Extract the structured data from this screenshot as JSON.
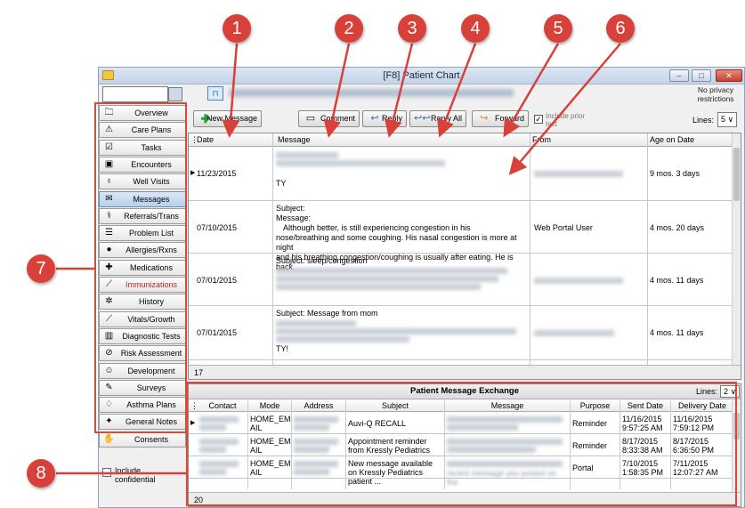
{
  "callouts": [
    "1",
    "2",
    "3",
    "4",
    "5",
    "6",
    "7",
    "8"
  ],
  "window": {
    "title": "[F8] Patient Chart",
    "minimize": "‒",
    "maximize": "□",
    "close": "✕"
  },
  "header": {
    "privacy": "No privacy restrictions"
  },
  "toolbar": {
    "new_message": "New Message",
    "comment": "Comment",
    "reply": "Reply",
    "reply_all": "Reply All",
    "forward": "Forward",
    "include_prior": "Include prior text",
    "include_checked": "✓",
    "lines_label": "Lines:",
    "lines_value": "5 ∨"
  },
  "nav": {
    "items": [
      {
        "label": "Overview",
        "icon": "folder-icon",
        "glyph": "🗀"
      },
      {
        "label": "Care Plans",
        "icon": "warning-icon",
        "glyph": "⚠"
      },
      {
        "label": "Tasks",
        "icon": "checklist-icon",
        "glyph": "☑"
      },
      {
        "label": "Encounters",
        "icon": "encounter-icon",
        "glyph": "▣"
      },
      {
        "label": "Well Visits",
        "icon": "stethoscope-icon",
        "glyph": "♁"
      },
      {
        "label": "Messages",
        "icon": "messages-icon",
        "glyph": "✉"
      },
      {
        "label": "Referrals/Trans",
        "icon": "referral-icon",
        "glyph": "⚕"
      },
      {
        "label": "Problem List",
        "icon": "problem-list-icon",
        "glyph": "☰"
      },
      {
        "label": "Allergies/Rxns",
        "icon": "allergy-icon",
        "glyph": "●"
      },
      {
        "label": "Medications",
        "icon": "medication-icon",
        "glyph": "✚"
      },
      {
        "label": "Immunizations",
        "icon": "syringe-icon",
        "glyph": "⟋"
      },
      {
        "label": "History",
        "icon": "history-icon",
        "glyph": "✲"
      },
      {
        "label": "Vitals/Growth",
        "icon": "vitals-icon",
        "glyph": "⟋"
      },
      {
        "label": "Diagnostic Tests",
        "icon": "diagnostic-icon",
        "glyph": "▥"
      },
      {
        "label": "Risk Assessment",
        "icon": "risk-icon",
        "glyph": "⊘"
      },
      {
        "label": "Development",
        "icon": "development-icon",
        "glyph": "☺"
      },
      {
        "label": "Surveys",
        "icon": "survey-icon",
        "glyph": "✎"
      },
      {
        "label": "Asthma Plans",
        "icon": "asthma-icon",
        "glyph": "♢"
      },
      {
        "label": "General Notes",
        "icon": "notes-icon",
        "glyph": "✦"
      },
      {
        "label": "Consents",
        "icon": "consent-icon",
        "glyph": "✋"
      }
    ],
    "include_confidential": "Include confidential"
  },
  "messages": {
    "columns": [
      "Date",
      "Message",
      "From",
      "Age on Date"
    ],
    "rows": [
      {
        "date": "11/23/2015",
        "message_lines": [
          "",
          "",
          "",
          "TY"
        ],
        "from": "",
        "age": "9 mos. 3 days",
        "selected": true
      },
      {
        "date": "07/10/2015",
        "message_lines": [
          "Subject:",
          "Message:",
          "Although better, is still experiencing congestion in his",
          "nose/breathing and some coughing. His nasal congestion is more at night",
          "and his breathing congestion/coughing is usually after eating. He is back"
        ],
        "from": "Web Portal User",
        "age": "4 mos. 20 days",
        "selected": false
      },
      {
        "date": "07/01/2015",
        "message_lines": [
          "Subject: sleep/congestion",
          "",
          "",
          ""
        ],
        "from": "",
        "age": "4 mos. 11 days",
        "selected": false
      },
      {
        "date": "07/01/2015",
        "message_lines": [
          "Subject: Message from mom",
          "",
          "",
          "TY!"
        ],
        "from": "",
        "age": "4 mos. 11 days",
        "selected": false
      }
    ],
    "footer_count": "17"
  },
  "exchange": {
    "title": "Patient Message Exchange",
    "lines_label": "Lines:",
    "lines_value": "2 ∨",
    "columns": [
      "Contact",
      "Mode",
      "Address",
      "Subject",
      "Message",
      "Purpose",
      "Sent Date",
      "Delivery Date"
    ],
    "rows": [
      {
        "mode": "HOME_EM AIL",
        "subject": "Auvi-Q RECALL",
        "purpose": "Reminder",
        "sent": "11/16/2015 9:57:25 AM",
        "delivery": "11/16/2015 7:59:12 PM",
        "message": ""
      },
      {
        "mode": "HOME_EM AIL",
        "subject": "Appointment reminder from Kressly Pediatrics",
        "purpose": "Reminder",
        "sent": "8/17/2015 8:33:38 AM",
        "delivery": "8/17/2015 6:36:50 PM",
        "message": ""
      },
      {
        "mode": "HOME_EM AIL",
        "subject": "New message available on Kressly Pediatrics patient ...",
        "purpose": "Portal",
        "sent": "7/10/2015 1:58:35 PM",
        "delivery": "7/11/2015 12:07:27 AM",
        "message": "recent message you posted on the"
      }
    ],
    "footer_count": "20"
  },
  "colors": {
    "callout": "#d8413a",
    "frame": "#e04535",
    "accent": "#b7cfea"
  }
}
